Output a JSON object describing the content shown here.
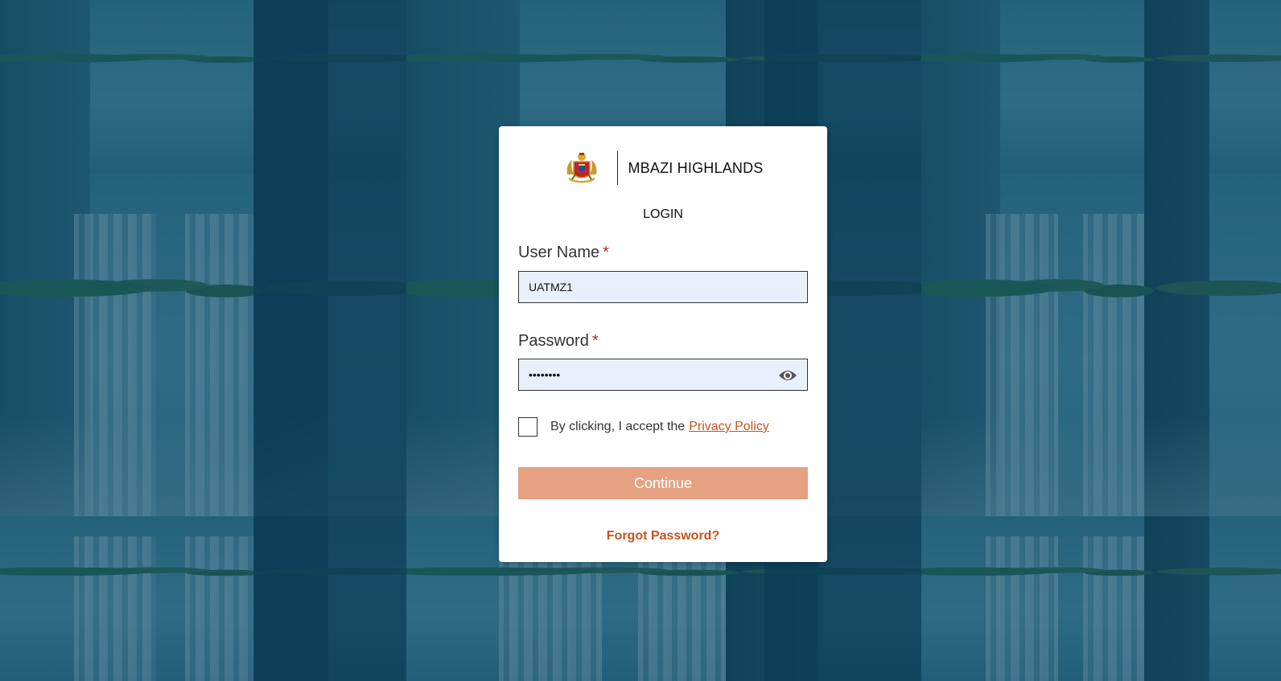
{
  "brand": {
    "emblem_icon": "state-emblem-icon",
    "title": "MBAZI HIGHLANDS"
  },
  "heading": "LOGIN",
  "username": {
    "label": "User Name",
    "required_mark": "*",
    "value": "UATMZ1"
  },
  "password": {
    "label": "Password",
    "required_mark": "*",
    "value": "••••••••",
    "toggle_icon": "eye-icon"
  },
  "consent": {
    "text": "By clicking, I accept the",
    "link": "Privacy Policy",
    "checked": false
  },
  "continue_label": "Continue",
  "forgot_label": "Forgot Password?",
  "colors": {
    "accent": "#c8521d",
    "button_disabled": "#e6a182",
    "required": "#b02a1e",
    "input_bg": "#e8f0fe",
    "overlay": "#0e4a66"
  }
}
